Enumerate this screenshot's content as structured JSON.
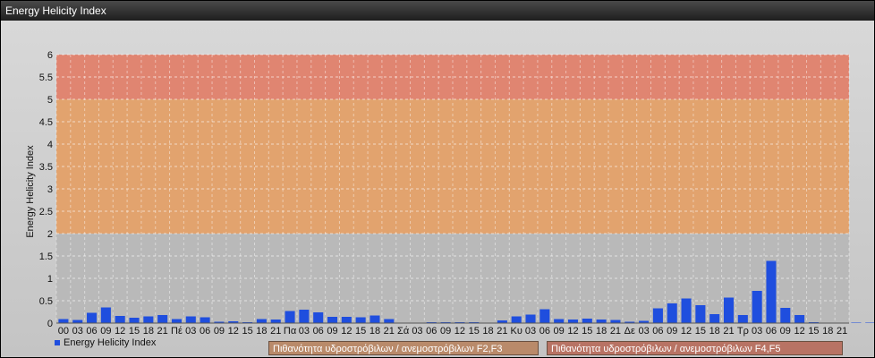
{
  "window": {
    "title": "Energy Helicity Index"
  },
  "legend": {
    "label": "Energy Helicity Index",
    "color": "#1f4ede"
  },
  "zones": {
    "zone1_label": "Πιθανότητα υδροστρόβιλων / ανεμοστρόβιλων F2,F3",
    "zone2_label": "Πιθανότητα υδροστρόβιλων / ανεμοστρόβιλων F4,F5"
  },
  "chart_data": {
    "type": "bar",
    "ylabel": "Energy Helicity Index",
    "ylim": [
      0,
      6
    ],
    "yticks": [
      "0",
      "0.5",
      "1",
      "1.5",
      "2",
      "2.5",
      "3",
      "3.5",
      "4",
      "4.5",
      "5",
      "5.5",
      "6"
    ],
    "bands": [
      {
        "from": 0,
        "to": 2,
        "color": "#b9b9b9"
      },
      {
        "from": 2,
        "to": 5,
        "color": "#e2a36e"
      },
      {
        "from": 5,
        "to": 6,
        "color": "#e08571"
      }
    ],
    "categories": [
      "00",
      "03",
      "06",
      "09",
      "12",
      "15",
      "18",
      "21",
      "Πέ",
      "03",
      "06",
      "09",
      "12",
      "15",
      "18",
      "21",
      "Πα",
      "03",
      "06",
      "09",
      "12",
      "15",
      "18",
      "21",
      "Σά",
      "03",
      "06",
      "09",
      "12",
      "15",
      "18",
      "21",
      "Κυ",
      "03",
      "06",
      "09",
      "12",
      "15",
      "18",
      "21",
      "Δε",
      "03",
      "06",
      "09",
      "12",
      "15",
      "18",
      "21",
      "Τρ",
      "03",
      "06",
      "09",
      "12",
      "15",
      "18",
      "21"
    ],
    "values": [
      0.09,
      0.07,
      0.23,
      0.35,
      0.16,
      0.12,
      0.15,
      0.18,
      0.09,
      0.15,
      0.13,
      0.03,
      0.04,
      0.02,
      0.09,
      0.08,
      0.27,
      0.3,
      0.24,
      0.14,
      0.14,
      0.13,
      0.17,
      0.09,
      0.01,
      0.01,
      0.02,
      0.02,
      0.02,
      0.02,
      0.01,
      0.06,
      0.15,
      0.19,
      0.31,
      0.09,
      0.08,
      0.1,
      0.08,
      0.07,
      0.03,
      0.05,
      0.33,
      0.44,
      0.55,
      0.4,
      0.2,
      0.57,
      0.18,
      0.72,
      1.39,
      0.34,
      0.18,
      0.02,
      0.01,
      0.01,
      0.01,
      0.01,
      0.01,
      0.01
    ],
    "grid": true,
    "legend_position": "bottom-left"
  }
}
